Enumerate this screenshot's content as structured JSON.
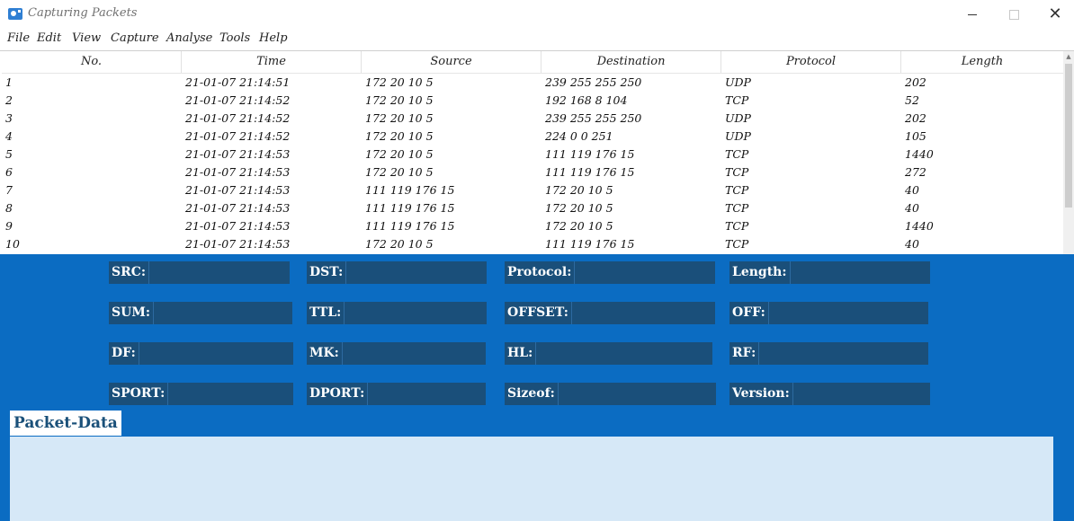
{
  "window": {
    "title": "Capturing Packets",
    "controls": {
      "minimize": "—",
      "close": "✕"
    }
  },
  "menu": [
    "File",
    "Edit",
    "View",
    "Capture",
    "Analyse",
    "Tools",
    "Help"
  ],
  "table": {
    "columns": [
      "No.",
      "Time",
      "Source",
      "Destination",
      "Protocol",
      "Length"
    ],
    "rows": [
      [
        "1",
        "21-01-07 21:14:51",
        "172 20 10 5",
        "239 255 255 250",
        "UDP",
        "202"
      ],
      [
        "2",
        "21-01-07 21:14:52",
        "172 20 10 5",
        "192 168 8 104",
        "TCP",
        "52"
      ],
      [
        "3",
        "21-01-07 21:14:52",
        "172 20 10 5",
        "239 255 255 250",
        "UDP",
        "202"
      ],
      [
        "4",
        "21-01-07 21:14:52",
        "172 20 10 5",
        "224 0 0 251",
        "UDP",
        "105"
      ],
      [
        "5",
        "21-01-07 21:14:53",
        "172 20 10 5",
        "111 119 176 15",
        "TCP",
        "1440"
      ],
      [
        "6",
        "21-01-07 21:14:53",
        "172 20 10 5",
        "111 119 176 15",
        "TCP",
        "272"
      ],
      [
        "7",
        "21-01-07 21:14:53",
        "111 119 176 15",
        "172 20 10 5",
        "TCP",
        "40"
      ],
      [
        "8",
        "21-01-07 21:14:53",
        "111 119 176 15",
        "172 20 10 5",
        "TCP",
        "40"
      ],
      [
        "9",
        "21-01-07 21:14:53",
        "111 119 176 15",
        "172 20 10 5",
        "TCP",
        "1440"
      ],
      [
        "10",
        "21-01-07 21:14:53",
        "172 20 10 5",
        "111 119 176 15",
        "TCP",
        "40"
      ]
    ]
  },
  "details": {
    "fields": [
      {
        "label": "SRC:",
        "value": ""
      },
      {
        "label": "DST:",
        "value": ""
      },
      {
        "label": "Protocol:",
        "value": ""
      },
      {
        "label": "Length:",
        "value": ""
      },
      {
        "label": "SUM:",
        "value": ""
      },
      {
        "label": "TTL:",
        "value": ""
      },
      {
        "label": "OFFSET:",
        "value": ""
      },
      {
        "label": "OFF:",
        "value": ""
      },
      {
        "label": "DF:",
        "value": ""
      },
      {
        "label": "MK:",
        "value": ""
      },
      {
        "label": "HL:",
        "value": ""
      },
      {
        "label": "RF:",
        "value": ""
      },
      {
        "label": "SPORT:",
        "value": ""
      },
      {
        "label": "DPORT:",
        "value": ""
      },
      {
        "label": "Sizeof:",
        "value": ""
      },
      {
        "label": "Version:",
        "value": ""
      }
    ],
    "packet_data_label": "Packet-Data",
    "packet_data": ""
  },
  "colors": {
    "panel": "#0b6cc2",
    "field": "#1a4f7a",
    "packet_area": "#d6e8f7"
  }
}
